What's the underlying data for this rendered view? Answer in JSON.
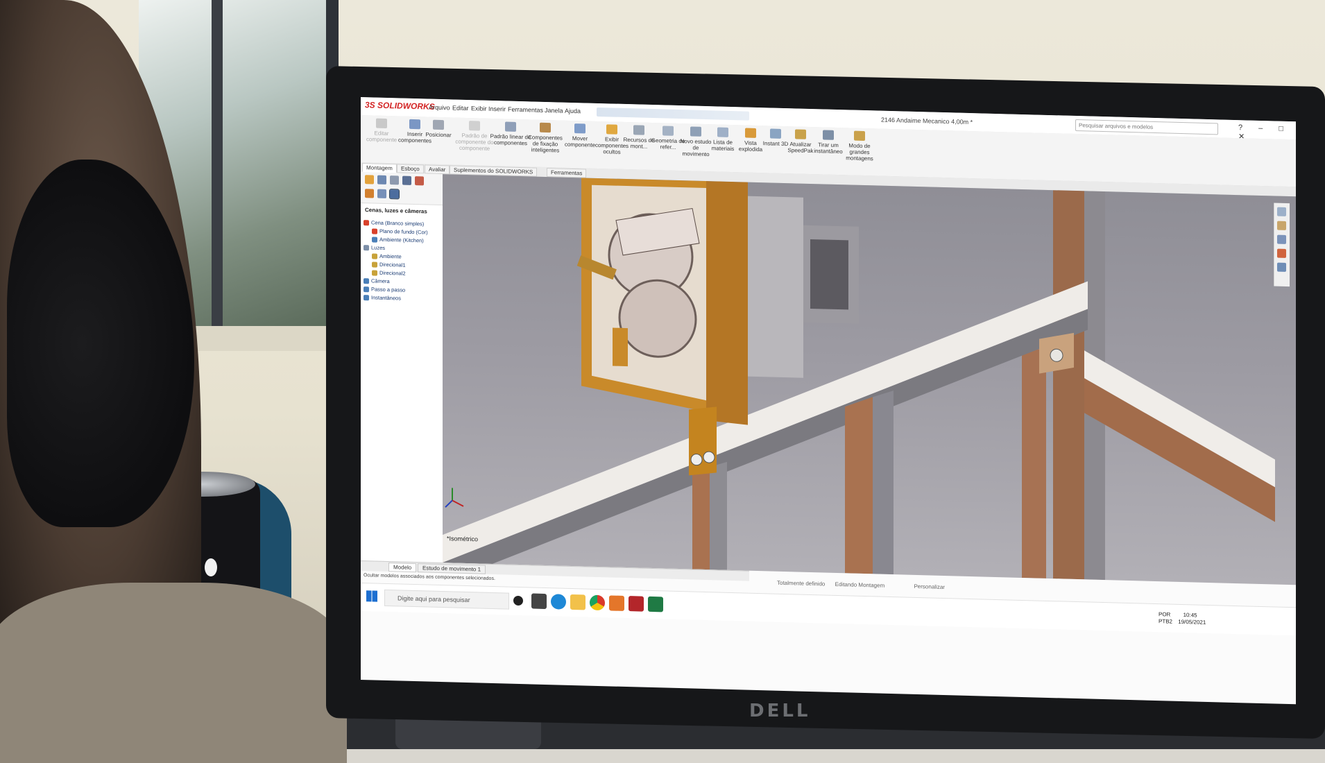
{
  "app": {
    "brand": "SOLIDWORKS",
    "logo_prefix": "3S",
    "menus": [
      "Arquivo",
      "Editar",
      "Exibir",
      "Inserir",
      "Ferramentas",
      "Janela",
      "Ajuda"
    ],
    "document_title": "2146 Andaime Mecanico 4,00m *",
    "search_placeholder": "Pesquisar arquivos e modelos",
    "window_controls": "? – □ ✕"
  },
  "ribbon": {
    "buttons": [
      {
        "label": "Editar componente",
        "icon": "edit-component-icon",
        "enabled": false
      },
      {
        "label": "Inserir componentes",
        "icon": "insert-components-icon"
      },
      {
        "label": "Posicionar",
        "icon": "mate-icon"
      },
      {
        "label": "Padrão de componente do componente",
        "icon": "component-pattern-icon",
        "enabled": false
      },
      {
        "label": "Padrão linear de componentes",
        "icon": "linear-pattern-icon"
      },
      {
        "label": "Componentes de fixação inteligentes",
        "icon": "smart-fasteners-icon"
      },
      {
        "label": "Mover componente",
        "icon": "move-component-icon"
      },
      {
        "label": "Exibir componentes ocultos",
        "icon": "show-hidden-icon"
      },
      {
        "label": "Recursos de mont...",
        "icon": "assembly-features-icon"
      },
      {
        "label": "Geometria de refer...",
        "icon": "reference-geometry-icon"
      },
      {
        "label": "Novo estudo de movimento",
        "icon": "motion-study-icon"
      },
      {
        "label": "Lista de materiais",
        "icon": "bom-icon"
      },
      {
        "label": "Vista explodida",
        "icon": "exploded-view-icon"
      },
      {
        "label": "Instant 3D",
        "icon": "instant3d-icon"
      },
      {
        "label": "Atualizar SpeedPak",
        "icon": "speedpak-icon"
      },
      {
        "label": "Tirar um instantâneo",
        "icon": "snapshot-icon"
      },
      {
        "label": "Modo de grandes montagens",
        "icon": "large-assembly-icon"
      }
    ]
  },
  "tabs": [
    "Montagem",
    "Esboço",
    "Avaliar",
    "Suplementos do SOLIDWORKS",
    "Ferramentas"
  ],
  "active_tab": "Montagem",
  "feature_manager": {
    "header": "Cenas, luzes e câmeras",
    "tree": [
      {
        "label": "Cena (Branco simples)",
        "depth": 0,
        "icon_color": "#d9412b"
      },
      {
        "label": "Plano de fundo (Cor)",
        "depth": 1,
        "icon_color": "#d9412b"
      },
      {
        "label": "Ambiente (Kitchen)",
        "depth": 1,
        "icon_color": "#4a7fb8"
      },
      {
        "label": "Luzes",
        "depth": 0,
        "icon_color": "#7d8fa8"
      },
      {
        "label": "Ambiente",
        "depth": 1,
        "icon_color": "#c8a23a"
      },
      {
        "label": "Direcional1",
        "depth": 1,
        "icon_color": "#c8a23a"
      },
      {
        "label": "Direcional2",
        "depth": 1,
        "icon_color": "#c8a23a"
      },
      {
        "label": "Câmera",
        "depth": 0,
        "icon_color": "#4a7fb8"
      },
      {
        "label": "Passo a passo",
        "depth": 0,
        "icon_color": "#4a7fb8"
      },
      {
        "label": "Instantâneos",
        "depth": 0,
        "icon_color": "#4a7fb8"
      }
    ]
  },
  "viewport": {
    "view_label": "*Isométrico"
  },
  "bottom_tabs": [
    "Modelo",
    "Estudo de movimento 1"
  ],
  "status": {
    "hint": "Ocultar modelos associados aos componentes selecionados.",
    "state": "Totalmente definido",
    "mode": "Editando Montagem",
    "units": "Personalizar"
  },
  "taskbar": {
    "search_placeholder": "Digite aqui para pesquisar",
    "apps": [
      "cortana-icon",
      "task-view-icon",
      "edge-icon",
      "file-explorer-icon",
      "chrome-icon",
      "powerpoint-icon",
      "solidworks-icon",
      "excel-icon"
    ],
    "language": "POR",
    "keyboard": "PTB2",
    "time": "10:45",
    "date": "19/05/2021"
  },
  "hardware": {
    "monitor_brand": "DELL"
  },
  "colors": {
    "brass": "#c98a2a",
    "copper": "#b5754a",
    "steel": "#8c8c8c",
    "white_part": "#f0ece6",
    "viewport_bg": "#9d9ba3",
    "sw_red": "#d32424"
  }
}
